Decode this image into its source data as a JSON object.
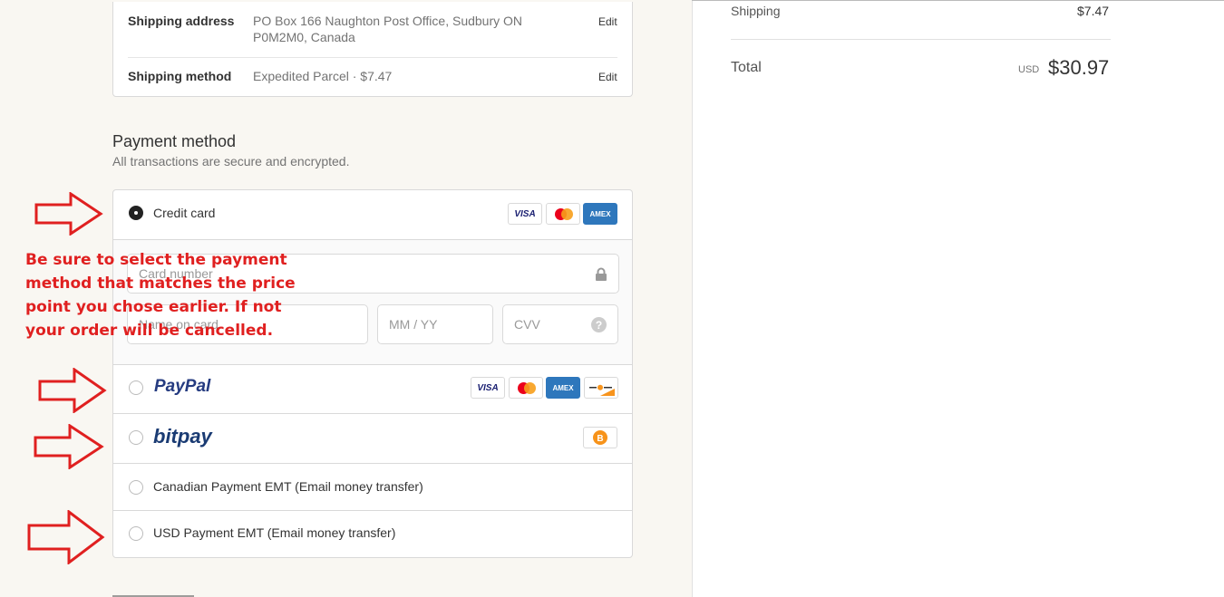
{
  "review": {
    "shipping_address_label": "Shipping address",
    "shipping_address_value": "PO Box 166 Naughton Post Office, Sudbury ON P0M2M0, Canada",
    "shipping_method_label": "Shipping method",
    "shipping_method_value": "Expedited Parcel · $7.47",
    "edit_label": "Edit"
  },
  "payment": {
    "title": "Payment method",
    "subtitle": "All transactions are secure and encrypted.",
    "options": [
      {
        "label": "Credit card",
        "selected": true
      },
      {
        "label": "PayPal",
        "selected": false
      },
      {
        "label": "bitpay",
        "selected": false
      },
      {
        "label": "Canadian Payment EMT (Email money transfer)",
        "selected": false
      },
      {
        "label": "USD Payment EMT (Email money transfer)",
        "selected": false
      }
    ],
    "card_fields": {
      "card_number": "Card number",
      "name_on_card": "Name on card",
      "expiry": "MM / YY",
      "cvv": "CVV"
    },
    "card_brands": {
      "visa": "VISA",
      "amex": "AMEX"
    }
  },
  "annotation": "Be sure to select the payment method that matches the price point you chose earlier. If not your order will be cancelled.",
  "summary": {
    "shipping_label": "Shipping",
    "shipping_value": "$7.47",
    "total_label": "Total",
    "currency": "USD",
    "total_value": "$30.97"
  },
  "colors": {
    "accent": "#e02020",
    "amex": "#2e77bc",
    "paypal_dark": "#253b80",
    "paypal_light": "#179bd7",
    "bitpay": "#1a3b73"
  }
}
